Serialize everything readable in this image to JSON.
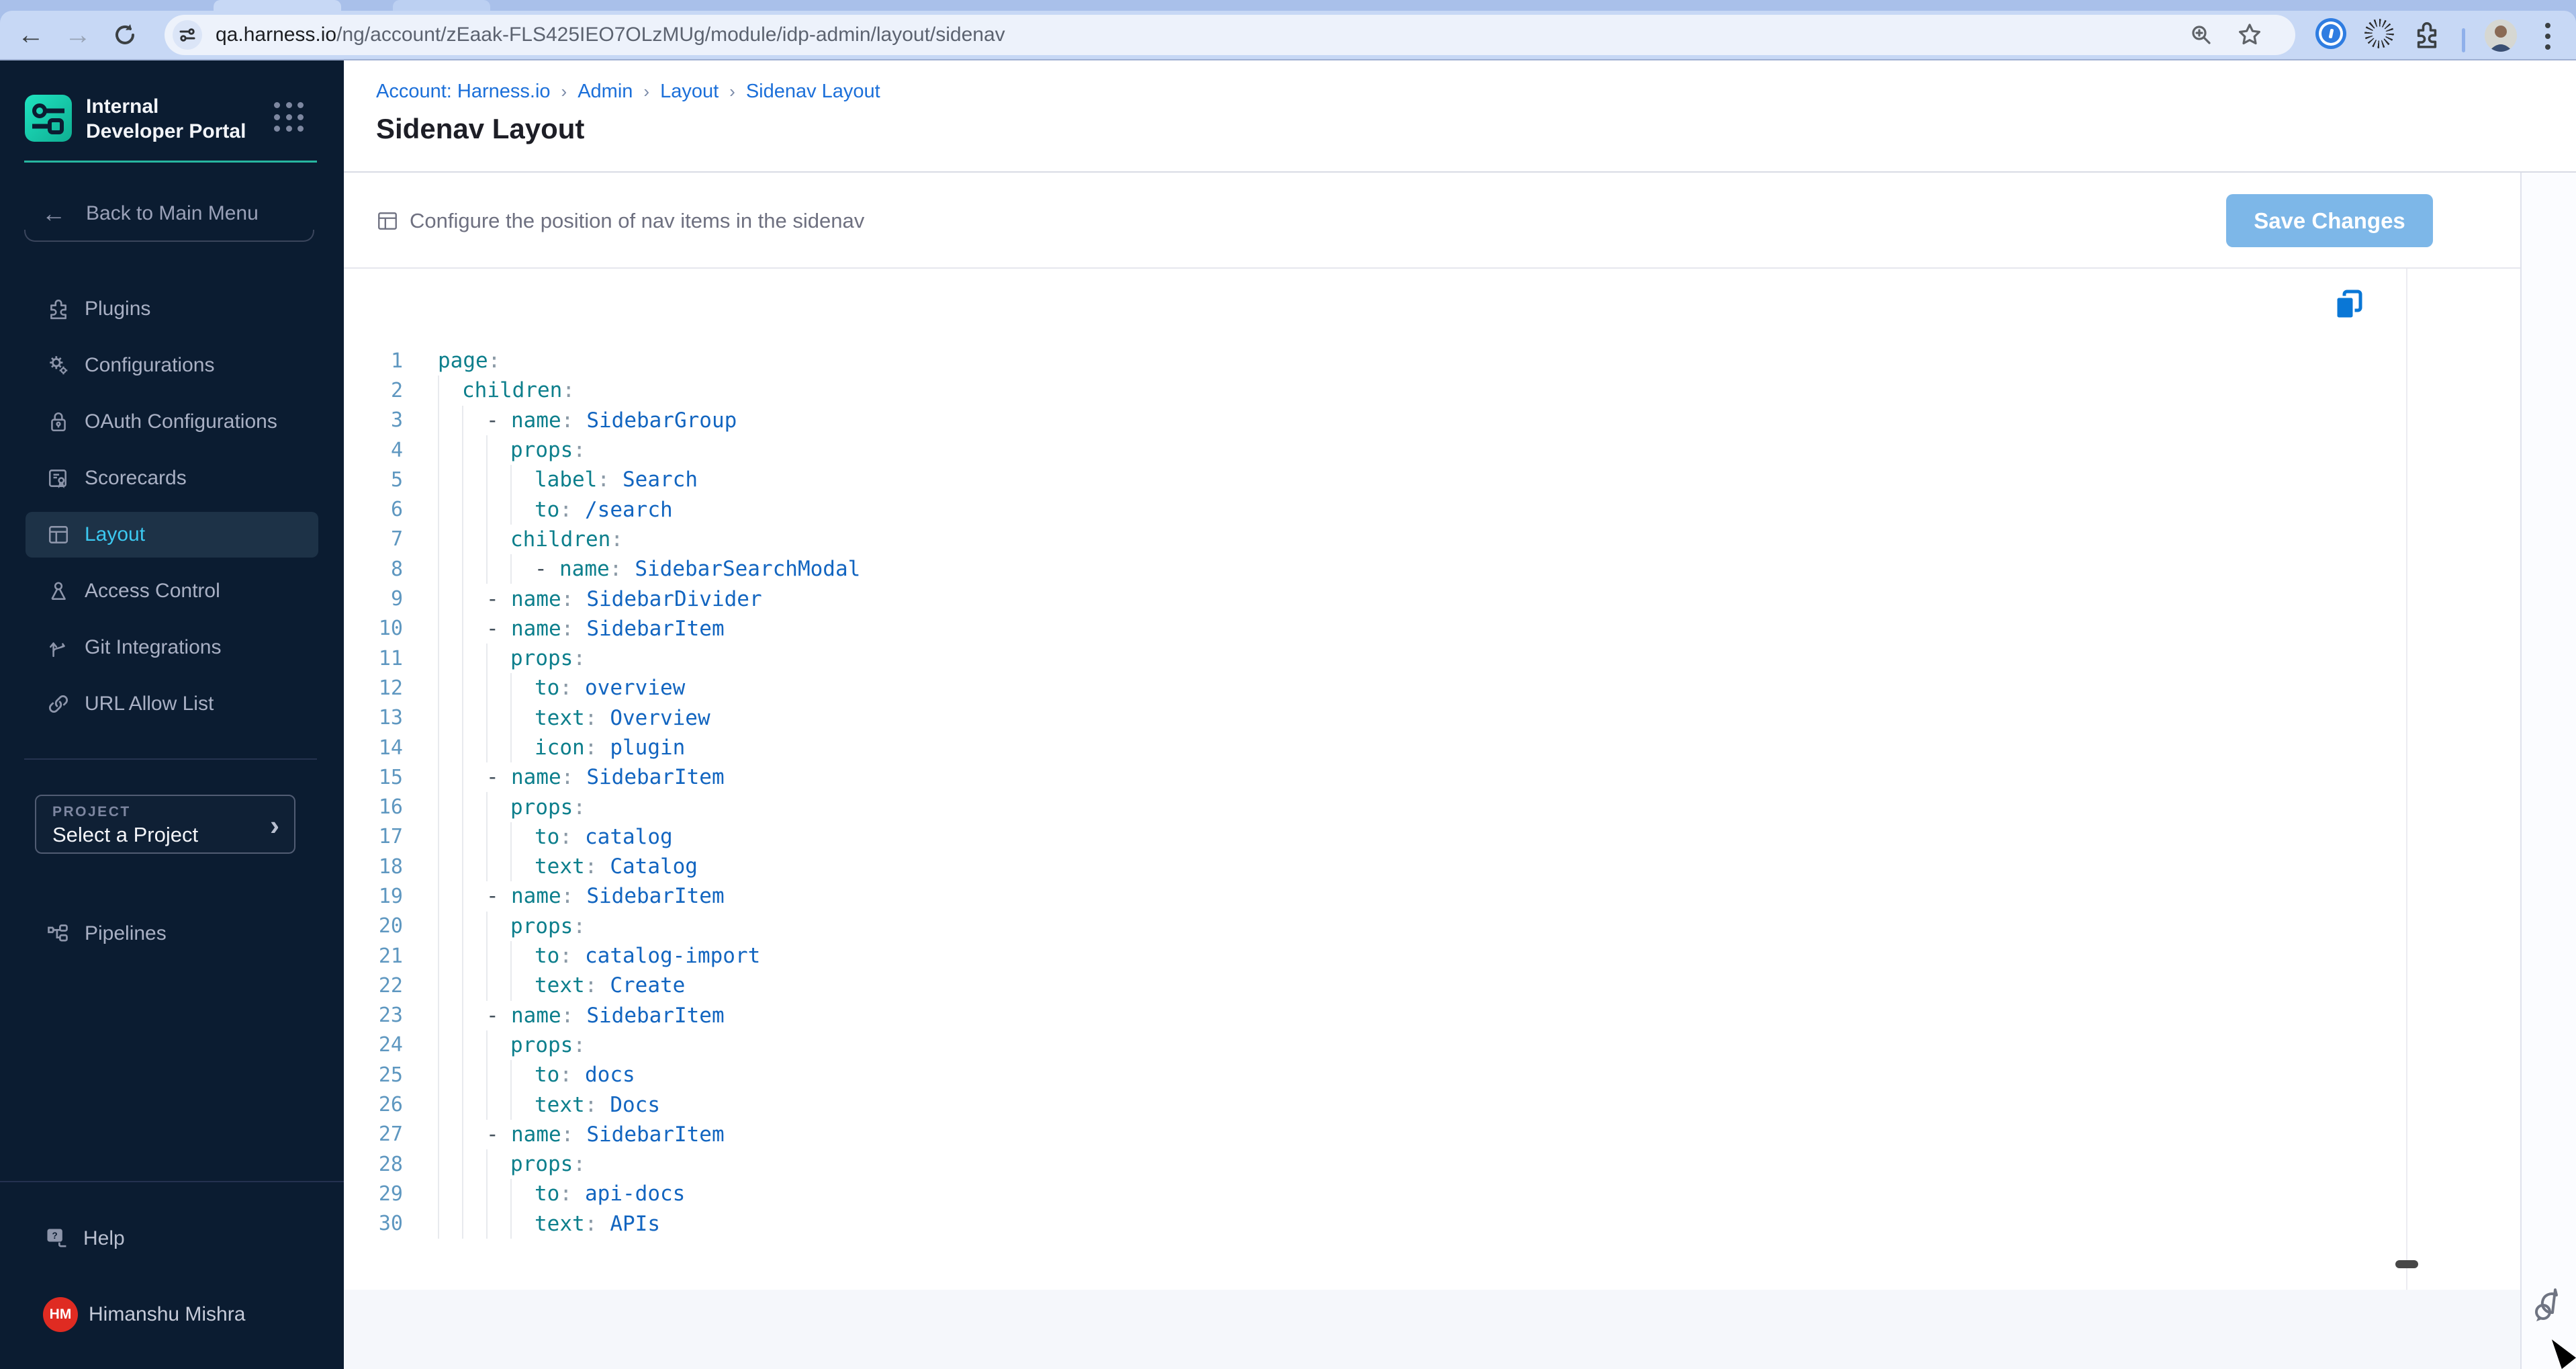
{
  "browser": {
    "url_host": "qa.harness.io",
    "url_path": "/ng/account/zEaak-FLS425IEO7OLzMUg/module/idp-admin/layout/sidenav"
  },
  "sidebar": {
    "app_title": "Internal Developer Portal",
    "back_label": "Back to Main Menu",
    "items": [
      {
        "label": "Plugins",
        "icon": "puzzle-icon",
        "active": false
      },
      {
        "label": "Configurations",
        "icon": "gears-icon",
        "active": false
      },
      {
        "label": "OAuth Configurations",
        "icon": "lock-icon",
        "active": false
      },
      {
        "label": "Scorecards",
        "icon": "scorecard-icon",
        "active": false
      },
      {
        "label": "Layout",
        "icon": "layout-icon",
        "active": true
      },
      {
        "label": "Access Control",
        "icon": "person-icon",
        "active": false
      },
      {
        "label": "Git Integrations",
        "icon": "git-branch-icon",
        "active": false
      },
      {
        "label": "URL Allow List",
        "icon": "link-icon",
        "active": false
      }
    ],
    "project_label": "PROJECT",
    "project_value": "Select a Project",
    "pipelines_label": "Pipelines",
    "help_label": "Help",
    "user": {
      "initials": "HM",
      "name": "Himanshu Mishra"
    }
  },
  "main": {
    "breadcrumb": [
      "Account: Harness.io",
      "Admin",
      "Layout",
      "Sidenav Layout"
    ],
    "title": "Sidenav Layout",
    "toolbar": {
      "description": "Configure the position of nav items in the sidenav",
      "save_label": "Save Changes"
    }
  },
  "editor": {
    "lines": [
      {
        "n": 1,
        "i": 0,
        "d": false,
        "k": "page",
        "v": null
      },
      {
        "n": 2,
        "i": 1,
        "d": false,
        "k": "children",
        "v": null
      },
      {
        "n": 3,
        "i": 2,
        "d": true,
        "k": "name",
        "v": "SidebarGroup"
      },
      {
        "n": 4,
        "i": 3,
        "d": false,
        "k": "props",
        "v": null
      },
      {
        "n": 5,
        "i": 4,
        "d": false,
        "k": "label",
        "v": "Search"
      },
      {
        "n": 6,
        "i": 4,
        "d": false,
        "k": "to",
        "v": "/search"
      },
      {
        "n": 7,
        "i": 3,
        "d": false,
        "k": "children",
        "v": null
      },
      {
        "n": 8,
        "i": 4,
        "d": true,
        "k": "name",
        "v": "SidebarSearchModal"
      },
      {
        "n": 9,
        "i": 2,
        "d": true,
        "k": "name",
        "v": "SidebarDivider"
      },
      {
        "n": 10,
        "i": 2,
        "d": true,
        "k": "name",
        "v": "SidebarItem"
      },
      {
        "n": 11,
        "i": 3,
        "d": false,
        "k": "props",
        "v": null
      },
      {
        "n": 12,
        "i": 4,
        "d": false,
        "k": "to",
        "v": "overview"
      },
      {
        "n": 13,
        "i": 4,
        "d": false,
        "k": "text",
        "v": "Overview"
      },
      {
        "n": 14,
        "i": 4,
        "d": false,
        "k": "icon",
        "v": "plugin"
      },
      {
        "n": 15,
        "i": 2,
        "d": true,
        "k": "name",
        "v": "SidebarItem"
      },
      {
        "n": 16,
        "i": 3,
        "d": false,
        "k": "props",
        "v": null
      },
      {
        "n": 17,
        "i": 4,
        "d": false,
        "k": "to",
        "v": "catalog"
      },
      {
        "n": 18,
        "i": 4,
        "d": false,
        "k": "text",
        "v": "Catalog"
      },
      {
        "n": 19,
        "i": 2,
        "d": true,
        "k": "name",
        "v": "SidebarItem"
      },
      {
        "n": 20,
        "i": 3,
        "d": false,
        "k": "props",
        "v": null
      },
      {
        "n": 21,
        "i": 4,
        "d": false,
        "k": "to",
        "v": "catalog-import"
      },
      {
        "n": 22,
        "i": 4,
        "d": false,
        "k": "text",
        "v": "Create"
      },
      {
        "n": 23,
        "i": 2,
        "d": true,
        "k": "name",
        "v": "SidebarItem"
      },
      {
        "n": 24,
        "i": 3,
        "d": false,
        "k": "props",
        "v": null
      },
      {
        "n": 25,
        "i": 4,
        "d": false,
        "k": "to",
        "v": "docs"
      },
      {
        "n": 26,
        "i": 4,
        "d": false,
        "k": "text",
        "v": "Docs"
      },
      {
        "n": 27,
        "i": 2,
        "d": true,
        "k": "name",
        "v": "SidebarItem"
      },
      {
        "n": 28,
        "i": 3,
        "d": false,
        "k": "props",
        "v": null
      },
      {
        "n": 29,
        "i": 4,
        "d": false,
        "k": "to",
        "v": "api-docs"
      },
      {
        "n": 30,
        "i": 4,
        "d": false,
        "k": "text",
        "v": "APIs"
      }
    ]
  },
  "colors": {
    "sidebar_bg": "#0b1c31",
    "accent_teal": "#27b6a0",
    "active_cyan": "#3cc8f0",
    "link_blue": "#1b6fd9",
    "code_key": "#0d7f8c",
    "code_value": "#1265c0",
    "save_disabled_blue": "#7db7e8",
    "avatar_red": "#df2b22",
    "copy_icon_blue": "#0a77d6"
  }
}
